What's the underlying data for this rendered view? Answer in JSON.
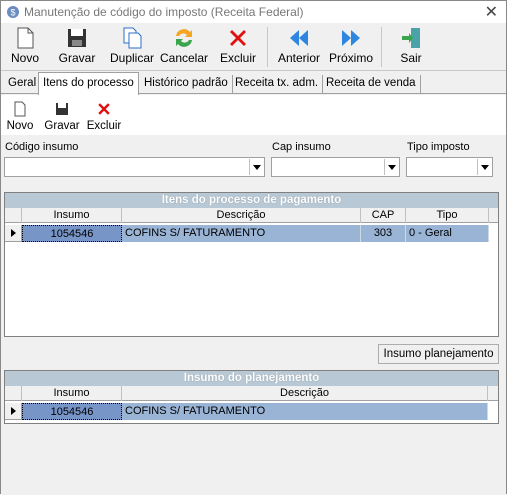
{
  "window": {
    "title": "Manutenção de código do imposto (Receita Federal)",
    "close_glyph": "✕"
  },
  "toolbar": {
    "novo": "Novo",
    "gravar": "Gravar",
    "duplicar": "Duplicar",
    "cancelar": "Cancelar",
    "excluir": "Excluir",
    "anterior": "Anterior",
    "proximo": "Próximo",
    "sair": "Sair"
  },
  "tabs": [
    "Geral",
    "Itens do processo",
    "Histórico padrão",
    "Receita tx. adm.",
    "Receita de venda"
  ],
  "subtoolbar": {
    "novo": "Novo",
    "gravar": "Gravar",
    "excluir": "Excluir"
  },
  "filters": {
    "codigo_insumo": {
      "label": "Código insumo",
      "value": ""
    },
    "cap_insumo": {
      "label": "Cap insumo",
      "value": ""
    },
    "tipo_imposto": {
      "label": "Tipo imposto",
      "value": ""
    }
  },
  "grid_pagamento": {
    "caption": "Itens do processo de pagamento",
    "columns": [
      "Insumo",
      "Descrição",
      "CAP",
      "Tipo"
    ],
    "rows": [
      {
        "insumo": "1054546",
        "descricao": "COFINS S/ FATURAMENTO",
        "cap": "303",
        "tipo": "0 - Geral"
      }
    ]
  },
  "insumo_planejamento_button": "Insumo planejamento",
  "grid_planejamento": {
    "caption": "Insumo do planejamento",
    "columns": [
      "Insumo",
      "Descrição"
    ],
    "rows": [
      {
        "insumo": "1054546",
        "descricao": "COFINS S/ FATURAMENTO"
      }
    ]
  }
}
